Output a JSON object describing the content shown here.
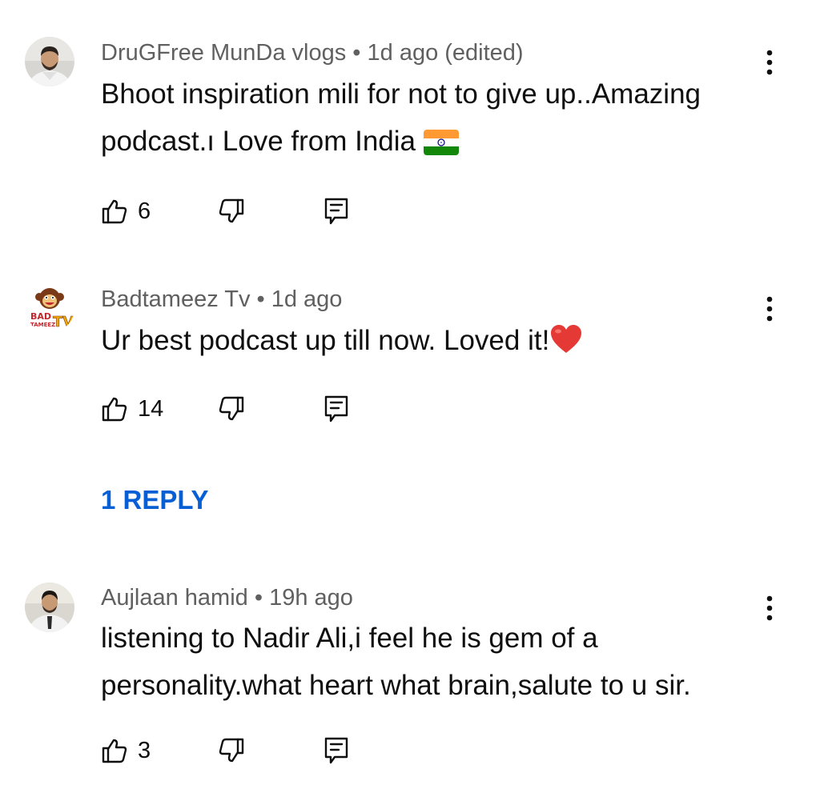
{
  "comments": [
    {
      "author": "DruGFree MunDa vlogs",
      "time": "1d ago (edited)",
      "text_line1": "Bhoot inspiration mili for not to give up..Amazing",
      "text_line2": "podcast.ı Love from India",
      "emoji_icon": "india-flag-emoji",
      "likes": "6"
    },
    {
      "author": "Badtameez Tv",
      "time": "1d ago",
      "text_line1": "Ur best podcast up till now. Loved it!",
      "emoji_icon": "red-heart-emoji",
      "likes": "14",
      "replies_label": "1 REPLY"
    },
    {
      "author": "Aujlaan hamid",
      "time": "19h ago",
      "text_line1": "listening to Nadir Ali,i feel he is gem of a",
      "text_line2": "personality.what heart what brain,salute to u sir.",
      "likes": "3"
    }
  ],
  "separator": " • ",
  "avatar_logo_text": {
    "bad": "BAD",
    "tameez": "TAMEEZ",
    "tv": "TV"
  },
  "colors": {
    "secondary_text": "#606060",
    "primary_text": "#0f0f0f",
    "link_blue": "#065fd4"
  }
}
